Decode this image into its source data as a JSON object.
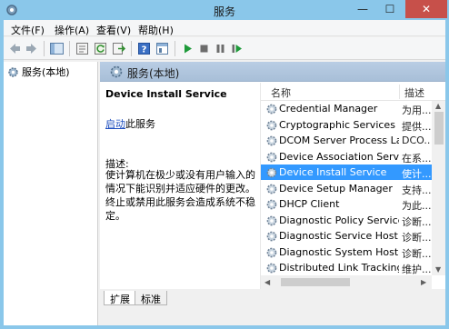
{
  "window": {
    "title": "服务",
    "minimize_glyph": "—",
    "maximize_glyph": "☐",
    "close_glyph": "✕"
  },
  "menu": {
    "file": "文件(F)",
    "action": "操作(A)",
    "view": "查看(V)",
    "help": "帮助(H)"
  },
  "toolbar_icons": [
    "back-icon",
    "forward-icon",
    "show-tree-icon",
    "properties-icon",
    "refresh-icon",
    "export-icon",
    "help-icon",
    "console-icon",
    "play-icon",
    "stop-icon",
    "pause-icon",
    "restart-icon"
  ],
  "tree": {
    "root_label": "服务(本地)"
  },
  "pane": {
    "header_title": "服务(本地)",
    "service_title": "Device Install Service",
    "start_link": "启动",
    "start_suffix": "此服务",
    "desc_label": "描述:",
    "desc_text": "使计算机在极少或没有用户输入的情况下能识别并适应硬件的更改。终止或禁用此服务会造成系统不稳定。"
  },
  "list": {
    "col_name": "名称",
    "col_desc": "描述",
    "rows": [
      {
        "name": "Credential Manager",
        "desc": "为用..."
      },
      {
        "name": "Cryptographic Services",
        "desc": "提供..."
      },
      {
        "name": "DCOM Server Process La...",
        "desc": "DCO..."
      },
      {
        "name": "Device Association Service",
        "desc": "在系..."
      },
      {
        "name": "Device Install Service",
        "desc": "使计..."
      },
      {
        "name": "Device Setup Manager",
        "desc": "支持..."
      },
      {
        "name": "DHCP Client",
        "desc": "为此..."
      },
      {
        "name": "Diagnostic Policy Service",
        "desc": "诊断..."
      },
      {
        "name": "Diagnostic Service Host",
        "desc": "诊断..."
      },
      {
        "name": "Diagnostic System Host",
        "desc": "诊断..."
      },
      {
        "name": "Distributed Link Tracking...",
        "desc": "维护..."
      }
    ],
    "selected_index": 4
  },
  "tabs": {
    "extended": "扩展",
    "standard": "标准"
  },
  "colors": {
    "frame": "#8ac7ea",
    "selection": "#3399ff",
    "link": "#1f4fbf",
    "close": "#c7504a"
  }
}
